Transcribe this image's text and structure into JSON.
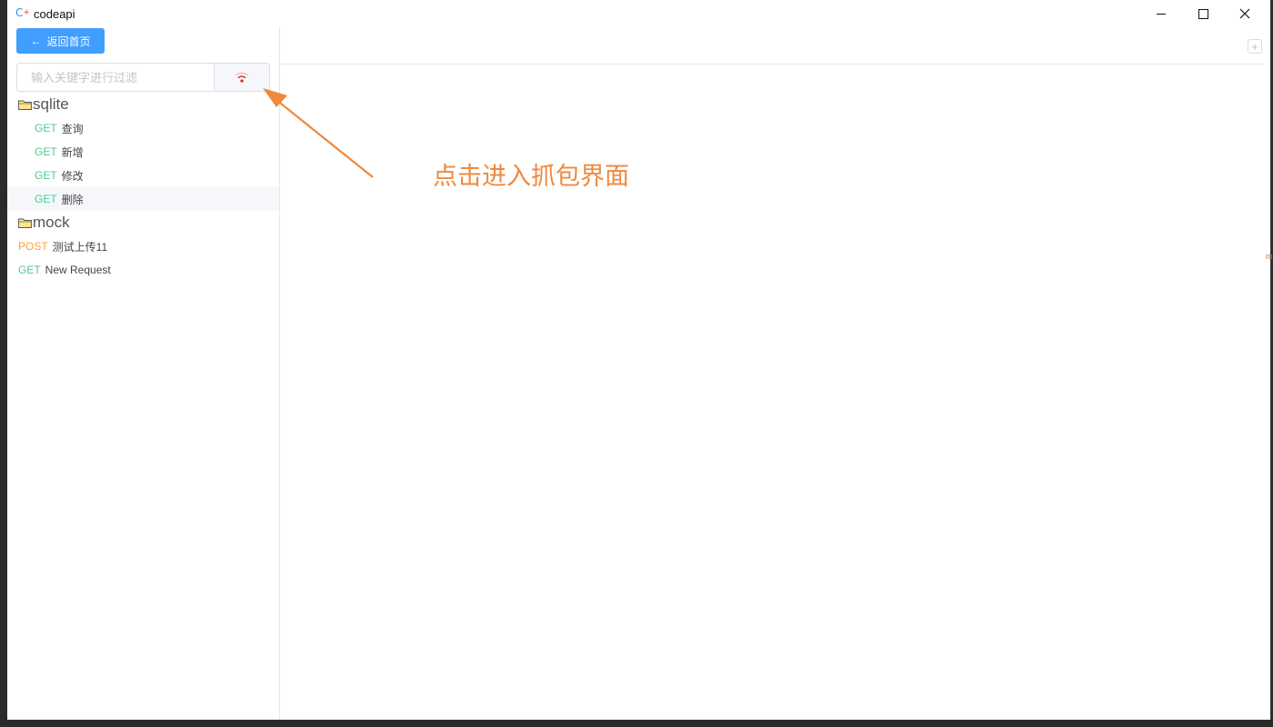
{
  "window": {
    "title": "codeapi",
    "logo_text": "C",
    "logo_mark": "+"
  },
  "sidebar": {
    "back_button": {
      "icon": "arrow-left-icon",
      "arrow": "←",
      "label": "返回首页"
    },
    "search": {
      "placeholder": "输入关键字进行过滤",
      "value": ""
    },
    "capture_button": {
      "icon": "wifi-icon"
    },
    "tree": {
      "folder_sqlite": {
        "name": "sqlite",
        "items": [
          {
            "method": "GET",
            "name": "查询"
          },
          {
            "method": "GET",
            "name": "新增"
          },
          {
            "method": "GET",
            "name": "修改"
          },
          {
            "method": "GET",
            "name": "删除"
          }
        ]
      },
      "folder_mock": {
        "name": "mock"
      },
      "root_items": [
        {
          "method": "POST",
          "name": "测试上传11"
        },
        {
          "method": "GET",
          "name": "New Request"
        }
      ]
    }
  },
  "main": {
    "add_tab_symbol": "+",
    "annotation": "点击进入抓包界面",
    "edge_mark": "m"
  },
  "colors": {
    "primary": "#409eff",
    "get": "#49cc90",
    "post": "#fca130",
    "annotation": "#f0883e",
    "wifi": "#e02020"
  }
}
